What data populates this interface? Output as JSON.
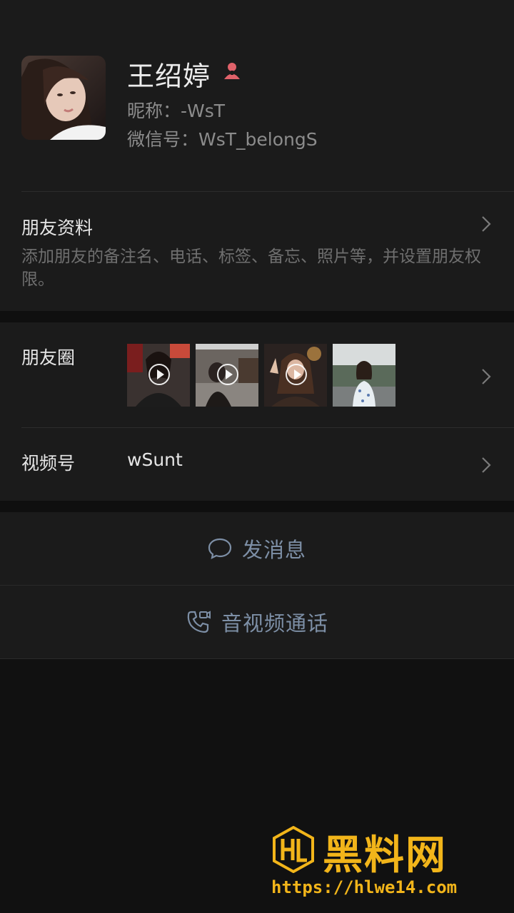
{
  "profile": {
    "name": "王绍婷",
    "nickname": "昵称：-WsT",
    "wechat_id": "微信号：WsT_belongS"
  },
  "friend_info": {
    "title": "朋友资料",
    "description": "添加朋友的备注名、电话、标签、备忘、照片等，并设置朋友权限。"
  },
  "moments": {
    "label": "朋友圈",
    "thumbs": [
      {
        "video": true
      },
      {
        "video": true
      },
      {
        "video": true
      },
      {
        "video": false
      }
    ]
  },
  "channels": {
    "label": "视频号",
    "value": "wSunt"
  },
  "actions": {
    "message": "发消息",
    "call": "音视频通话"
  },
  "watermark": {
    "title": "黑料网",
    "url": "https://hlwe14.com"
  },
  "colors": {
    "background": "#111111",
    "card": "#1b1b1b",
    "action_text": "#7d8fa6",
    "watermark": "#f2b51a",
    "gender_female": "#e0626a"
  }
}
